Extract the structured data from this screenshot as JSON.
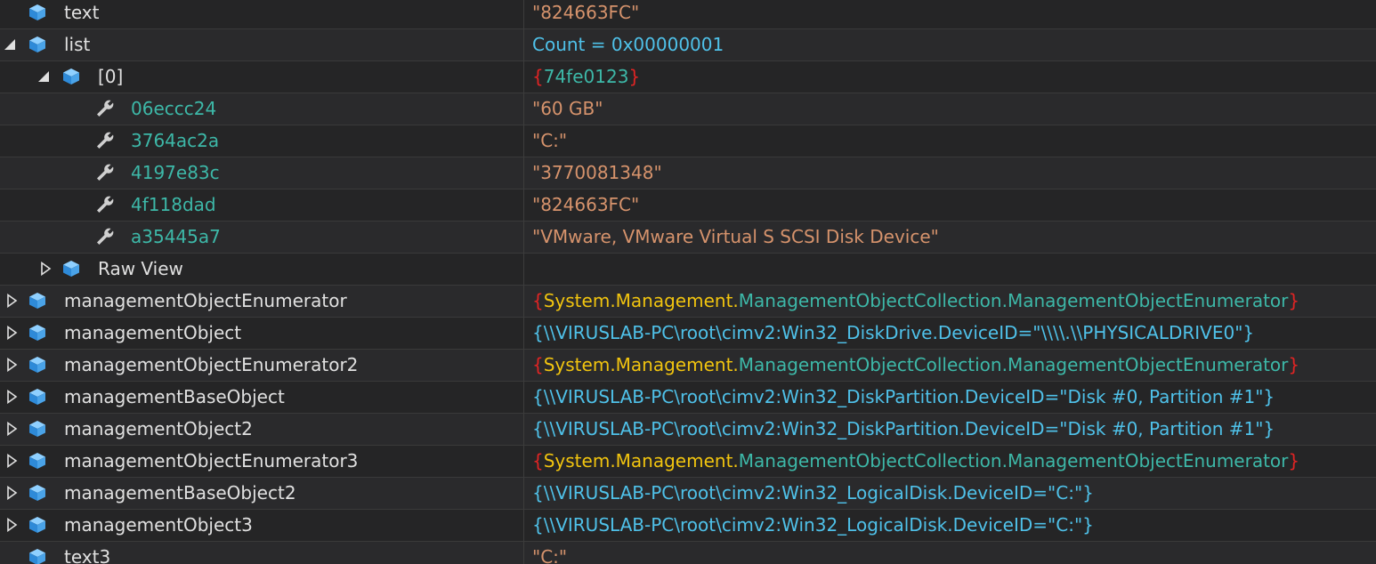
{
  "colors": {
    "background": "#252526",
    "string_value": "#d6936c",
    "count_value": "#4fc1e9",
    "type_name": "#3db8a8",
    "namespace": "#f1c40f",
    "brace": "#e02424",
    "object_icon": "#4aa3e8",
    "property_icon": "#d0d0d0"
  },
  "rows": [
    {
      "name": "text",
      "value": "\"824663FC\""
    },
    {
      "name": "list",
      "value": "Count = 0x00000001"
    },
    {
      "name": "[0]",
      "value": {
        "open": "{",
        "text": "74fe0123",
        "close": "}"
      }
    },
    {
      "name": "06eccc24",
      "value": "\"60 GB\""
    },
    {
      "name": "3764ac2a",
      "value": "\"C:\""
    },
    {
      "name": "4197e83c",
      "value": "\"3770081348\""
    },
    {
      "name": "4f118dad",
      "value": "\"824663FC\""
    },
    {
      "name": "a35445a7",
      "value": "\"VMware, VMware Virtual S SCSI Disk Device\""
    },
    {
      "name": "Raw View",
      "value": ""
    },
    {
      "name": "managementObjectEnumerator",
      "value": {
        "open": "{",
        "ns": "System.Management.",
        "type": "ManagementObjectCollection.ManagementObjectEnumerator",
        "close": "}"
      }
    },
    {
      "name": "managementObject",
      "value": "{\\\\VIRUSLAB-PC\\root\\cimv2:Win32_DiskDrive.DeviceID=\"\\\\\\\\.\\\\PHYSICALDRIVE0\"}"
    },
    {
      "name": "managementObjectEnumerator2",
      "value": {
        "open": "{",
        "ns": "System.Management.",
        "type": "ManagementObjectCollection.ManagementObjectEnumerator",
        "close": "}"
      }
    },
    {
      "name": "managementBaseObject",
      "value": "{\\\\VIRUSLAB-PC\\root\\cimv2:Win32_DiskPartition.DeviceID=\"Disk #0, Partition #1\"}"
    },
    {
      "name": "managementObject2",
      "value": "{\\\\VIRUSLAB-PC\\root\\cimv2:Win32_DiskPartition.DeviceID=\"Disk #0, Partition #1\"}"
    },
    {
      "name": "managementObjectEnumerator3",
      "value": {
        "open": "{",
        "ns": "System.Management.",
        "type": "ManagementObjectCollection.ManagementObjectEnumerator",
        "close": "}"
      }
    },
    {
      "name": "managementBaseObject2",
      "value": "{\\\\VIRUSLAB-PC\\root\\cimv2:Win32_LogicalDisk.DeviceID=\"C:\"}"
    },
    {
      "name": "managementObject3",
      "value": "{\\\\VIRUSLAB-PC\\root\\cimv2:Win32_LogicalDisk.DeviceID=\"C:\"}"
    },
    {
      "name": "text3",
      "value": "\"C:\""
    }
  ]
}
